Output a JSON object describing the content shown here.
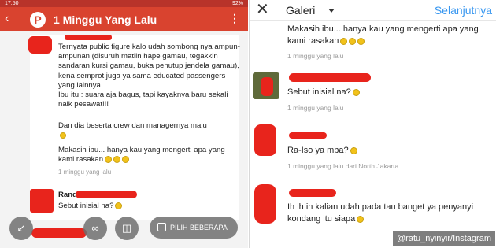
{
  "left": {
    "status": {
      "time": "17:50",
      "battery": "92%"
    },
    "header": {
      "title": "1 Minggu Yang Lalu",
      "logo": "P"
    },
    "comment1": {
      "paragraphs": [
        "Ternyata public figure kalo udah sombong nya ampun-ampunan (disuruh matiin hape gamau, tegakkin sandaran kursi gamau, buka penutup jendela gamau), kena semprot juga ya sama educated passengers yang lainnya...",
        "Ibu itu : suara aja bagus, tapi kayaknya baru sekali naik pesawat!!!",
        "Dan dia beserta crew dan managernya malu",
        "Makasih ibu... hanya kau yang mengerti apa yang kami rasakan"
      ],
      "time": "1 minggu yang lalu"
    },
    "comment2": {
      "name": "Randy Nelson",
      "text": "Sebut inisial na?"
    },
    "toolbar": {
      "select_label": "PILIH BEBERAPA"
    }
  },
  "right": {
    "header": {
      "title": "Galeri",
      "next": "Selanjutnya"
    },
    "comments": [
      {
        "text": "Makasih ibu... hanya kau yang mengerti apa yang kami rasakan",
        "time": "1 minggu yang lalu"
      },
      {
        "text": "Sebut inisial na?",
        "time": "1 minggu yang lalu"
      },
      {
        "text": "Ra-Iso ya mba?",
        "time": "1 minggu yang lalu dari North Jakarta"
      },
      {
        "text": "Ih ih ih kalian udah pada tau banget ya penyanyi kondang itu siapa"
      }
    ]
  },
  "watermark": "@ratu_nyinyir/Instagram",
  "colors": {
    "accent": "#d9432f",
    "link": "#3897f0",
    "redact": "#e8241c"
  }
}
